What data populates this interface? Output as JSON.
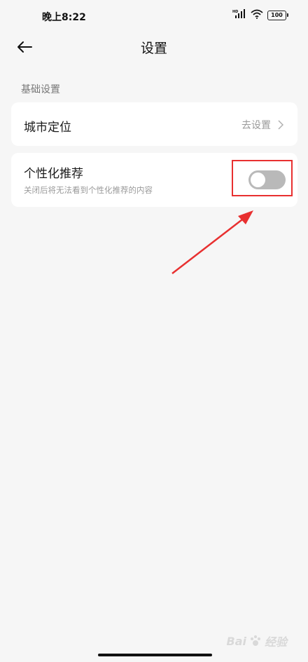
{
  "status_bar": {
    "time": "晚上8:22",
    "hd_label": "HD",
    "battery": "100"
  },
  "header": {
    "title": "设置"
  },
  "section": {
    "title": "基础设置"
  },
  "city_location": {
    "label": "城市定位",
    "action_label": "去设置"
  },
  "personalized_recommendation": {
    "label": "个性化推荐",
    "description": "关闭后将无法看到个性化推荐的内容",
    "enabled": false
  },
  "watermark": {
    "brand": "Bai",
    "suffix": "经验"
  },
  "colors": {
    "background": "#f6f6f6",
    "card": "#ffffff",
    "toggle_off": "#b9b9b9",
    "annotation_red": "#e83030"
  }
}
